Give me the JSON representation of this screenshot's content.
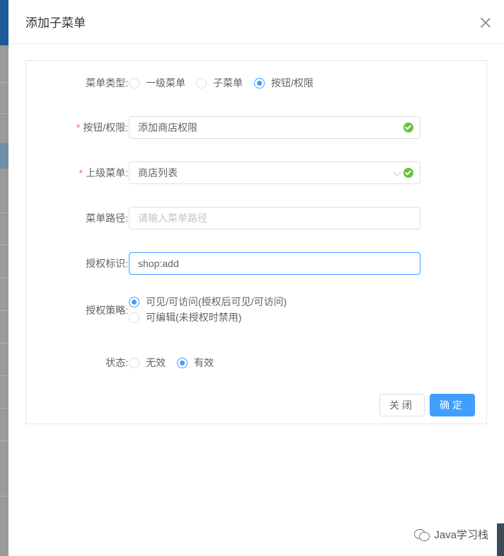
{
  "dialog": {
    "title": "添加子菜单"
  },
  "form": {
    "menu_type": {
      "label": "菜单类型:",
      "options": [
        "一级菜单",
        "子菜单",
        "按钮/权限"
      ],
      "selected": "按钮/权限"
    },
    "button_perm": {
      "label": "按钮/权限:",
      "value": "添加商店权限",
      "required": "*"
    },
    "parent_menu": {
      "label": "上级菜单:",
      "value": "商店列表",
      "required": "*"
    },
    "menu_path": {
      "label": "菜单路径:",
      "placeholder": "请输入菜单路径",
      "value": ""
    },
    "auth_id": {
      "label": "授权标识:",
      "value": "shop:add"
    },
    "auth_policy": {
      "label": "授权策略:",
      "options": [
        "可见/可访问(授权后可见/可访问)",
        "可编辑(未授权时禁用)"
      ],
      "selected": "可见/可访问(授权后可见/可访问)"
    },
    "status": {
      "label": "状态:",
      "options": [
        "无效",
        "有效"
      ],
      "selected": "有效"
    }
  },
  "footer": {
    "close_label": "关闭",
    "ok_label": "确定"
  },
  "watermark": {
    "text": "Java学习栈"
  },
  "icons": [
    "close-icon",
    "success-check-icon",
    "chevron-down-icon",
    "wechat-icon"
  ],
  "colors": {
    "primary": "#409eff",
    "success": "#67c23a",
    "required": "#f56c6c"
  }
}
